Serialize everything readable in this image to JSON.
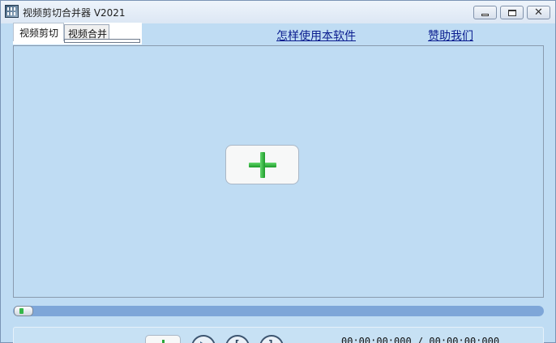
{
  "window": {
    "title": "视频剪切合并器 V2021"
  },
  "tabs": [
    {
      "label": "视频剪切",
      "selected": true
    },
    {
      "label": "视频合并",
      "selected": false
    }
  ],
  "links": {
    "howto": "怎样使用本软件",
    "donate": "赞助我们"
  },
  "preview": {
    "add_button_icon": "plus-icon"
  },
  "timeline": {
    "position_fraction": 0.0
  },
  "controls": {
    "time_display": "00:00:00:000 / 00:00:00:000",
    "play_icon": "play-icon",
    "mark_in_icon": "bracket-left-icon",
    "mark_out_icon": "bracket-right-icon"
  },
  "colors": {
    "background": "#bfdcf3",
    "timeline": "#7ea6d8",
    "plus_green": "#1d9a2a",
    "link": "#0a1d8f"
  }
}
